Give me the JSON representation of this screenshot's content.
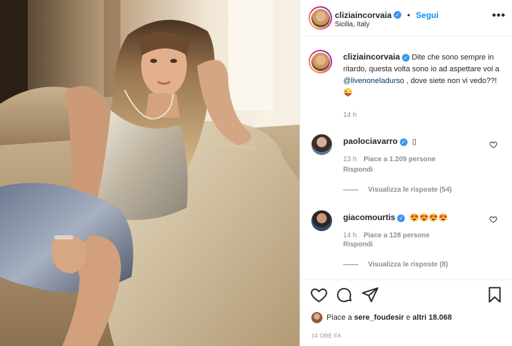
{
  "post": {
    "image_alt": "Donna bionda in abito argentato seduta su un divano",
    "author": "cliziaincorvaia",
    "follow_label": "Segui",
    "location": "Sicilia, Italy",
    "more_label": "•••"
  },
  "caption": {
    "username": "cliziaincorvaia",
    "text_before": "Dite che sono sempre in ritardo, questa volta sono io ad aspettare voi a ",
    "mention": "@livenoneladurso",
    "text_after": " , dove siete non vi vedo??!😜",
    "time": "14 h"
  },
  "comments": [
    {
      "username": "paolociavarro",
      "text": "▯",
      "time": "13 h",
      "likes": "Piace a 1.209 persone",
      "reply": "Rispondi",
      "view_replies": "Visualizza le risposte (54)"
    },
    {
      "username": "giacomourtis",
      "text": "😍😍😍😍",
      "time": "14 h",
      "likes": "Piace a 128 persone",
      "reply": "Rispondi",
      "view_replies": "Visualizza le risposte (8)"
    }
  ],
  "footer": {
    "likes_prefix": "Piace a ",
    "likes_user": "sere_foudesir",
    "likes_middle": " e ",
    "likes_count": "altri 18.068",
    "timestamp": "14 ORE FA"
  },
  "icons": [
    "heart-icon",
    "comment-icon",
    "share-icon",
    "bookmark-icon",
    "verified-icon",
    "more-icon"
  ],
  "colors": {
    "link_blue": "#0095f6",
    "verified_blue": "#3897f0",
    "mention": "#00376b",
    "secondary_text": "#8e8e8e"
  }
}
